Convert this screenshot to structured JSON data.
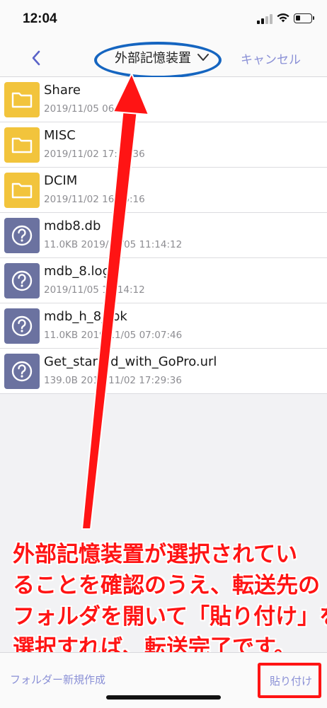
{
  "status_bar": {
    "time": "12:04",
    "icons": [
      "cellular-signal-icon",
      "wifi-icon",
      "battery-icon"
    ]
  },
  "nav": {
    "back_icon": "chevron-left-icon",
    "title": "外部記憶装置",
    "title_icon": "chevron-down-icon",
    "cancel_label": "キャンセル",
    "accent_color": "#8a90d6"
  },
  "files": [
    {
      "name": "Share",
      "meta": "2019/11/05 06:41:14",
      "type": "folder",
      "icon": "folder-icon"
    },
    {
      "name": "MISC",
      "meta": "2019/11/02 17:29:36",
      "type": "folder",
      "icon": "folder-icon"
    },
    {
      "name": "DCIM",
      "meta": "2019/11/02 16:35:16",
      "type": "folder",
      "icon": "folder-icon"
    },
    {
      "name": "mdb8.db",
      "meta": "11.0KB 2019/11/05 11:14:12",
      "type": "unknown",
      "icon": "question-file-icon"
    },
    {
      "name": "mdb_8.log",
      "meta": "2019/11/05 11:14:12",
      "type": "unknown",
      "icon": "question-file-icon"
    },
    {
      "name": "mdb_h_8_.bk",
      "meta": "11.0KB 2019/11/05 07:07:46",
      "type": "unknown",
      "icon": "question-file-icon"
    },
    {
      "name": "Get_started_with_GoPro.url",
      "meta": "139.0B 2019/11/02 17:29:36",
      "type": "unknown",
      "icon": "question-file-icon"
    }
  ],
  "annotation": {
    "lines": [
      "外部記憶装置が選択されてい",
      "ることを確認のうえ、転送先の",
      "フォルダを開いて「貼り付け」を",
      "選択すれば、転送完了です。"
    ],
    "color": "#ff1414",
    "highlight_color": "#1565c0"
  },
  "toolbar": {
    "new_folder_label": "フォルダー新規作成",
    "paste_label": "貼り付け"
  }
}
